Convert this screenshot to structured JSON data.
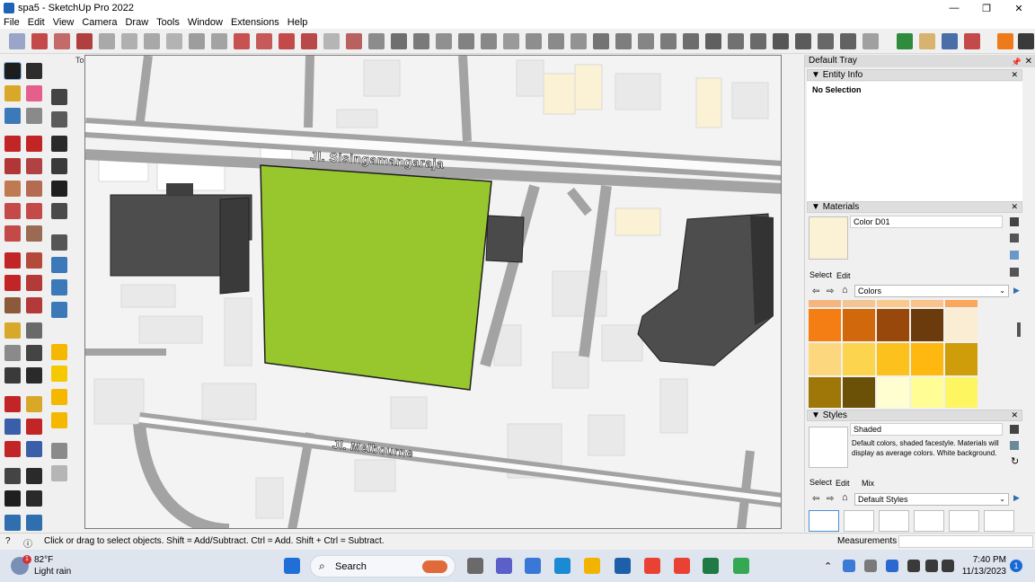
{
  "window": {
    "title": "spa5 - SketchUp Pro 2022",
    "controls": [
      "—",
      "❐",
      "✕"
    ]
  },
  "menu": [
    "File",
    "Edit",
    "View",
    "Camera",
    "Draw",
    "Tools",
    "Window",
    "Extensions",
    "Help"
  ],
  "viewport": {
    "view_label": "Top",
    "street_top": "Jl. Sisingamangaraja",
    "street_bottom": "Jl. Melbourne"
  },
  "tray": {
    "title": "Default Tray",
    "entity_info": {
      "title": "Entity Info",
      "selection": "No Selection"
    },
    "materials": {
      "title": "Materials",
      "current_name": "Color D01",
      "current_color": "#fbf1d4",
      "tab_select": "Select",
      "tab_edit": "Edit",
      "library": "Colors",
      "palette": [
        "#f4b580",
        "#f2c694",
        "#f9c98e",
        "#f9c48b",
        "#f8a75b",
        "#f47e14",
        "#d1680b",
        "#99480b",
        "#6b3b0e",
        "#fbedd3",
        "#fdd77e",
        "#fdd44d",
        "#fdc11d",
        "#feb80f",
        "#cf9d0a",
        "#9e7708",
        "#6a5107",
        "#fffed1",
        "#fffd93",
        "#fef661"
      ]
    },
    "styles": {
      "title": "Styles",
      "current_name": "Shaded",
      "description": "Default colors, shaded facestyle.  Materials will display as average colors.  White background.",
      "tab_select": "Select",
      "tab_edit": "Edit",
      "tab_mix": "Mix",
      "library": "Default Styles"
    }
  },
  "status": {
    "hint": "Click or drag to select objects. Shift = Add/Subtract. Ctrl = Add. Shift + Ctrl = Subtract.",
    "measurements_label": "Measurements"
  },
  "taskbar": {
    "weather_temp": "82°F",
    "weather_condition": "Light rain",
    "weather_badge": "1",
    "search_label": "Search",
    "time": "7:40 PM",
    "date": "11/13/2023",
    "notification_count": "1"
  }
}
